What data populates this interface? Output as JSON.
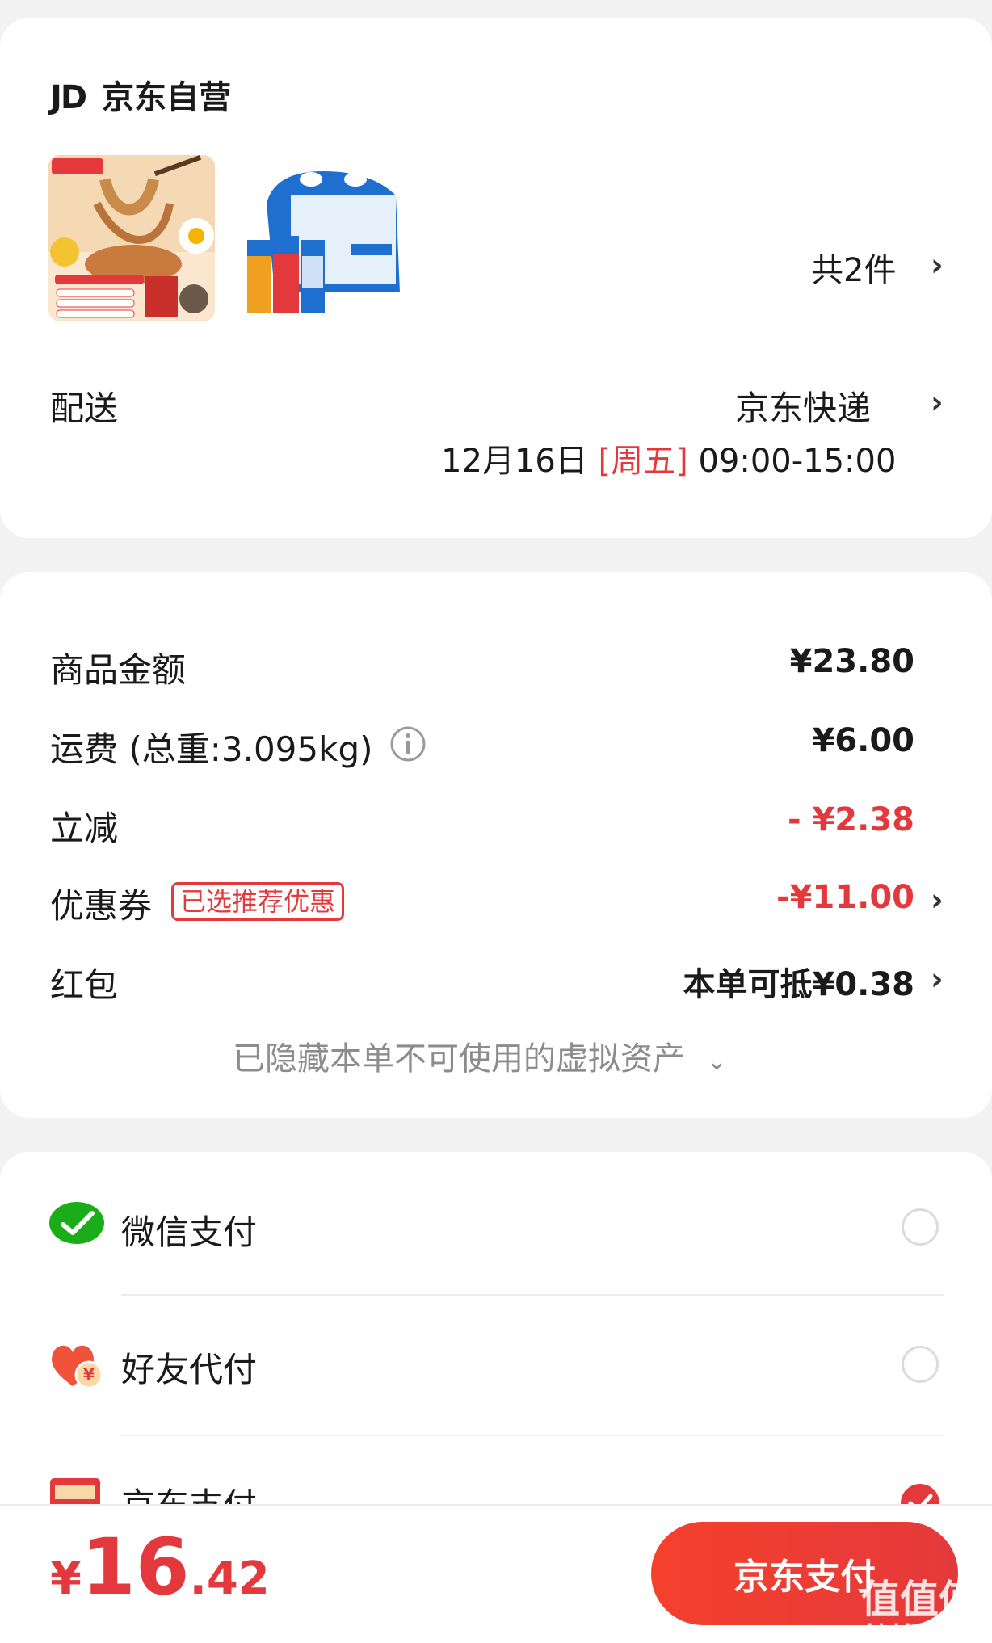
{
  "store": {
    "logo": "JD",
    "name": "京东自营"
  },
  "items": {
    "count_label": "共2件"
  },
  "delivery": {
    "label": "配送",
    "carrier": "京东快递",
    "date": "12月16日",
    "weekday": "[周五]",
    "time": "09:00-15:00"
  },
  "summary": {
    "goods_label": "商品金额",
    "goods_value": "¥23.80",
    "shipping_label": "运费 (总重:3.095kg)",
    "shipping_value": "¥6.00",
    "discount_label": "立减",
    "discount_value": "- ¥2.38",
    "coupon_label": "优惠券",
    "coupon_tag": "已选推荐优惠",
    "coupon_value": "-¥11.00",
    "redpacket_label": "红包",
    "redpacket_value": "本单可抵¥0.38",
    "hidden_assets": "已隐藏本单不可使用的虚拟资产"
  },
  "payment": {
    "methods": [
      {
        "label": "微信支付",
        "icon": "wechat-pay-icon",
        "selected": false
      },
      {
        "label": "好友代付",
        "icon": "friend-pay-icon",
        "selected": false
      },
      {
        "label": "京东支付",
        "icon": "jd-pay-card-icon",
        "selected": true
      }
    ]
  },
  "footer": {
    "currency": "¥",
    "total_int": "16",
    "total_dec": ".42",
    "pay_button": "京东支付"
  },
  "watermark": {
    "main": "值值值",
    "sub": "zhizhizhi.com"
  },
  "colors": {
    "accent": "#e4393c",
    "background": "#f2f2f2",
    "wechat": "#1aad19"
  }
}
